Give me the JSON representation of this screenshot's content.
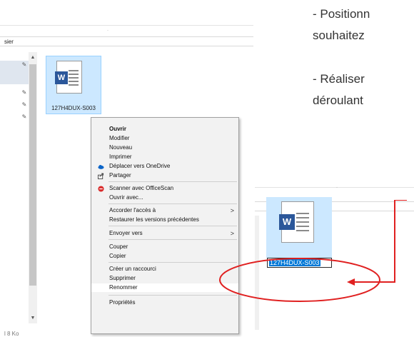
{
  "instructions": {
    "line1": "- Positionn",
    "line2": "souhaitez",
    "line3": "- Réaliser",
    "line4": "déroulant"
  },
  "left_window": {
    "path_text": "sier",
    "status_text": "l 8 Ko",
    "file": {
      "name": "127H4DUX-S003",
      "badge": "W"
    }
  },
  "context_menu": {
    "items": [
      {
        "label": "Ouvrir"
      },
      {
        "label": "Modifier"
      },
      {
        "label": "Nouveau"
      },
      {
        "label": "Imprimer"
      },
      {
        "label": "Déplacer vers OneDrive",
        "icon": "onedrive-cloud-icon"
      },
      {
        "label": "Partager",
        "icon": "share-icon"
      },
      {
        "label": "Scanner avec OfficeScan",
        "icon": "officescan-icon"
      },
      {
        "label": "Ouvrir avec..."
      },
      {
        "label": "Accorder l'accès à"
      },
      {
        "label": "Restaurer les versions précédentes"
      },
      {
        "label": "Envoyer vers"
      },
      {
        "label": "Couper"
      },
      {
        "label": "Copier"
      },
      {
        "label": "Créer un raccourci"
      },
      {
        "label": "Supprimer"
      },
      {
        "label": "Renommer"
      },
      {
        "label": "Propriétés"
      }
    ],
    "submenu_chevron": ">"
  },
  "right_window": {
    "file": {
      "name": "127H4DUX-S003",
      "badge": "W"
    }
  },
  "colors": {
    "selection_bg": "#cce8ff",
    "rename_highlight": "#0078d7",
    "annotation_red": "#e02020",
    "word_blue": "#2b579a"
  }
}
